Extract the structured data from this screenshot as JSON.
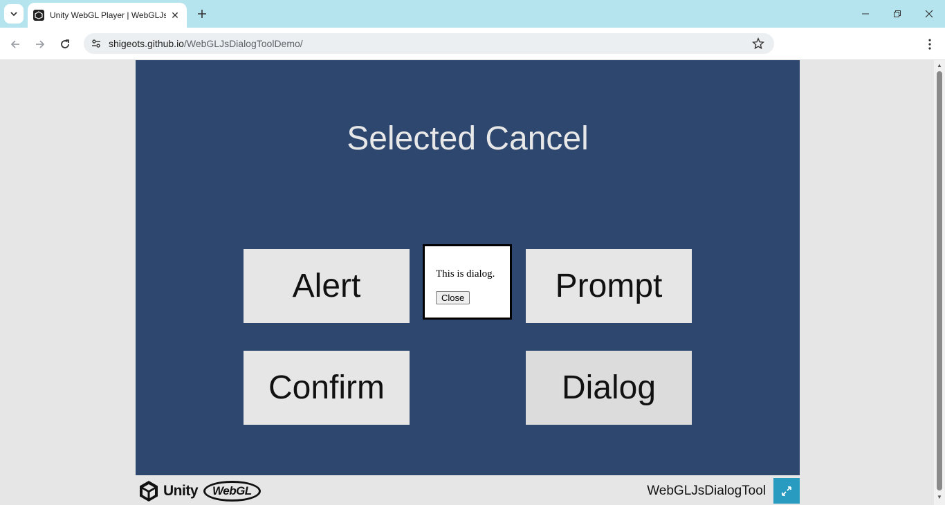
{
  "browser": {
    "tab_title": "Unity WebGL Player | WebGLJsDialogTool",
    "url_host": "shigeots.github.io",
    "url_path": "/WebGLJsDialogToolDemo/"
  },
  "app": {
    "heading": "Selected Cancel",
    "buttons": {
      "alert": "Alert",
      "prompt": "Prompt",
      "confirm": "Confirm",
      "dialog": "Dialog"
    },
    "dialog": {
      "text": "This is dialog.",
      "close_label": "Close"
    },
    "footer": {
      "unity_label": "Unity",
      "webgl_label": "WebGL",
      "title": "WebGLJsDialogTool"
    }
  },
  "colors": {
    "canvas_bg": "#2e476f",
    "button_bg": "#e6e6e6",
    "fullscreen_bg": "#2a9bc0",
    "tabstrip_bg": "#b5e4ef"
  }
}
